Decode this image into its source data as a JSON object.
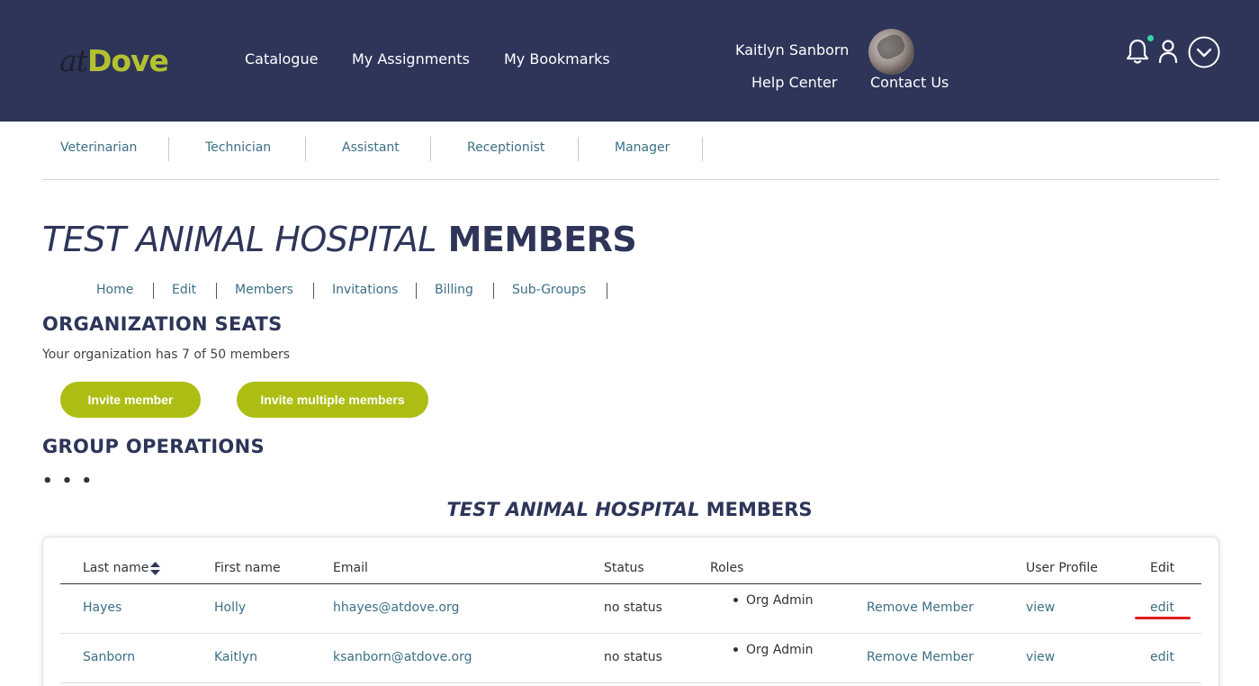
{
  "header": {
    "logo_at": "at",
    "logo_dove": "Dove",
    "nav": [
      "Catalogue",
      "My Assignments",
      "My Bookmarks"
    ],
    "user_name": "Kaitlyn Sanborn",
    "help_center": "Help Center",
    "contact_us": "Contact Us"
  },
  "roles": [
    "Veterinarian",
    "Technician",
    "Assistant",
    "Receptionist",
    "Manager"
  ],
  "page_title": {
    "italic": "TEST ANIMAL HOSPITAL",
    "bold": "MEMBERS"
  },
  "subnav": [
    "Home",
    "Edit",
    "Members",
    "Invitations",
    "Billing",
    "Sub-Groups"
  ],
  "seats": {
    "heading": "ORGANIZATION SEATS",
    "text": "Your organization has 7 of 50 members",
    "invite_button": "Invite member",
    "invite_multiple_button": "Invite multiple members"
  },
  "group_ops": {
    "heading": "GROUP OPERATIONS",
    "dots": "• • •"
  },
  "table": {
    "title_italic": "TEST ANIMAL HOSPITAL",
    "title_bold": "MEMBERS",
    "columns": [
      "Last name",
      "First name",
      "Email",
      "Status",
      "Roles",
      "User Profile",
      "Edit"
    ],
    "rows": [
      {
        "last": "Hayes",
        "first": "Holly",
        "email": "hhayes@atdove.org",
        "status": "no status",
        "role": "Org Admin",
        "remove": "Remove Member",
        "view": "view",
        "edit": "edit"
      },
      {
        "last": "Sanborn",
        "first": "Kaitlyn",
        "email": "ksanborn@atdove.org",
        "status": "no status",
        "role": "Org Admin",
        "remove": "Remove Member",
        "view": "view",
        "edit": "edit"
      }
    ]
  },
  "colors": {
    "header_bg": "#2e3559",
    "accent": "#aebd13",
    "link": "#3c6f86",
    "annotation": "#e01e1e"
  }
}
